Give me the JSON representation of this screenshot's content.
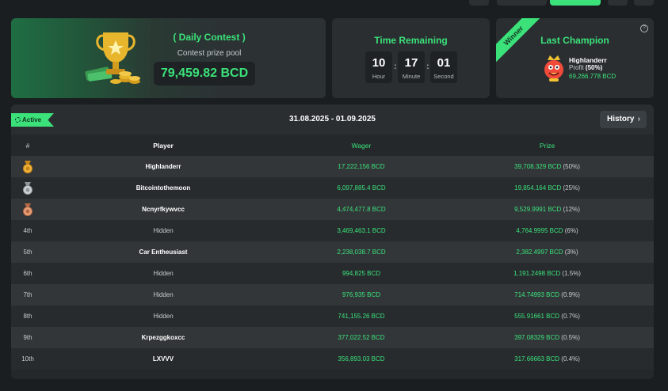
{
  "contest": {
    "title": "Daily Contest",
    "subtitle": "Contest prize pool",
    "prize_pool": "79,459.82 BCD"
  },
  "timer": {
    "title": "Time Remaining",
    "hour": "10",
    "hour_label": "Hour",
    "minute": "17",
    "minute_label": "Minute",
    "second": "01",
    "second_label": "Second"
  },
  "champion": {
    "ribbon": "Winner",
    "title": "Last Champion",
    "name": "Highlanderr",
    "profit_label": "Profit",
    "profit_pct": "(50%)",
    "amount": "69,266.778 BCD",
    "help_icon": "question-circle-icon"
  },
  "board": {
    "status": "Active",
    "date_range": "31.08.2025 - 01.09.2025",
    "history_label": "History",
    "columns": {
      "rank": "#",
      "player": "Player",
      "wager": "Wager",
      "prize": "Prize"
    },
    "rows": [
      {
        "rank": "",
        "medal": "gold",
        "player": "Highlanderr",
        "wager": "17,222,156 BCD",
        "prize": "39,708.329 BCD",
        "pct": "(50%)"
      },
      {
        "rank": "",
        "medal": "silver",
        "player": "Bitcointothemoon",
        "wager": "6,097,885.4 BCD",
        "prize": "19,854.164 BCD",
        "pct": "(25%)"
      },
      {
        "rank": "",
        "medal": "bronze",
        "player": "Ncnyrfkywvcc",
        "wager": "4,474,477.8 BCD",
        "prize": "9,529.9991 BCD",
        "pct": "(12%)"
      },
      {
        "rank": "4th",
        "player": "Hidden",
        "hidden": true,
        "wager": "3,469,463.1 BCD",
        "prize": "4,764.9995 BCD",
        "pct": "(6%)"
      },
      {
        "rank": "5th",
        "player": "Car Entheusiast",
        "wager": "2,238,038.7 BCD",
        "prize": "2,382.4997 BCD",
        "pct": "(3%)"
      },
      {
        "rank": "6th",
        "player": "Hidden",
        "hidden": true,
        "wager": "994,825 BCD",
        "prize": "1,191.2498 BCD",
        "pct": "(1.5%)"
      },
      {
        "rank": "7th",
        "player": "Hidden",
        "hidden": true,
        "wager": "976,935 BCD",
        "prize": "714.74993 BCD",
        "pct": "(0.9%)"
      },
      {
        "rank": "8th",
        "player": "Hidden",
        "hidden": true,
        "wager": "741,155.26 BCD",
        "prize": "555.91661 BCD",
        "pct": "(0.7%)"
      },
      {
        "rank": "9th",
        "player": "Krpezggkoxcc",
        "wager": "377,022.52 BCD",
        "prize": "397.08329 BCD",
        "pct": "(0.5%)"
      },
      {
        "rank": "10th",
        "player": "LXVVV",
        "wager": "356,893.03 BCD",
        "prize": "317.66663 BCD",
        "pct": "(0.4%)"
      }
    ]
  },
  "colors": {
    "accent": "#3be27a",
    "background": "#1b1e20",
    "card": "#2a2e31"
  }
}
